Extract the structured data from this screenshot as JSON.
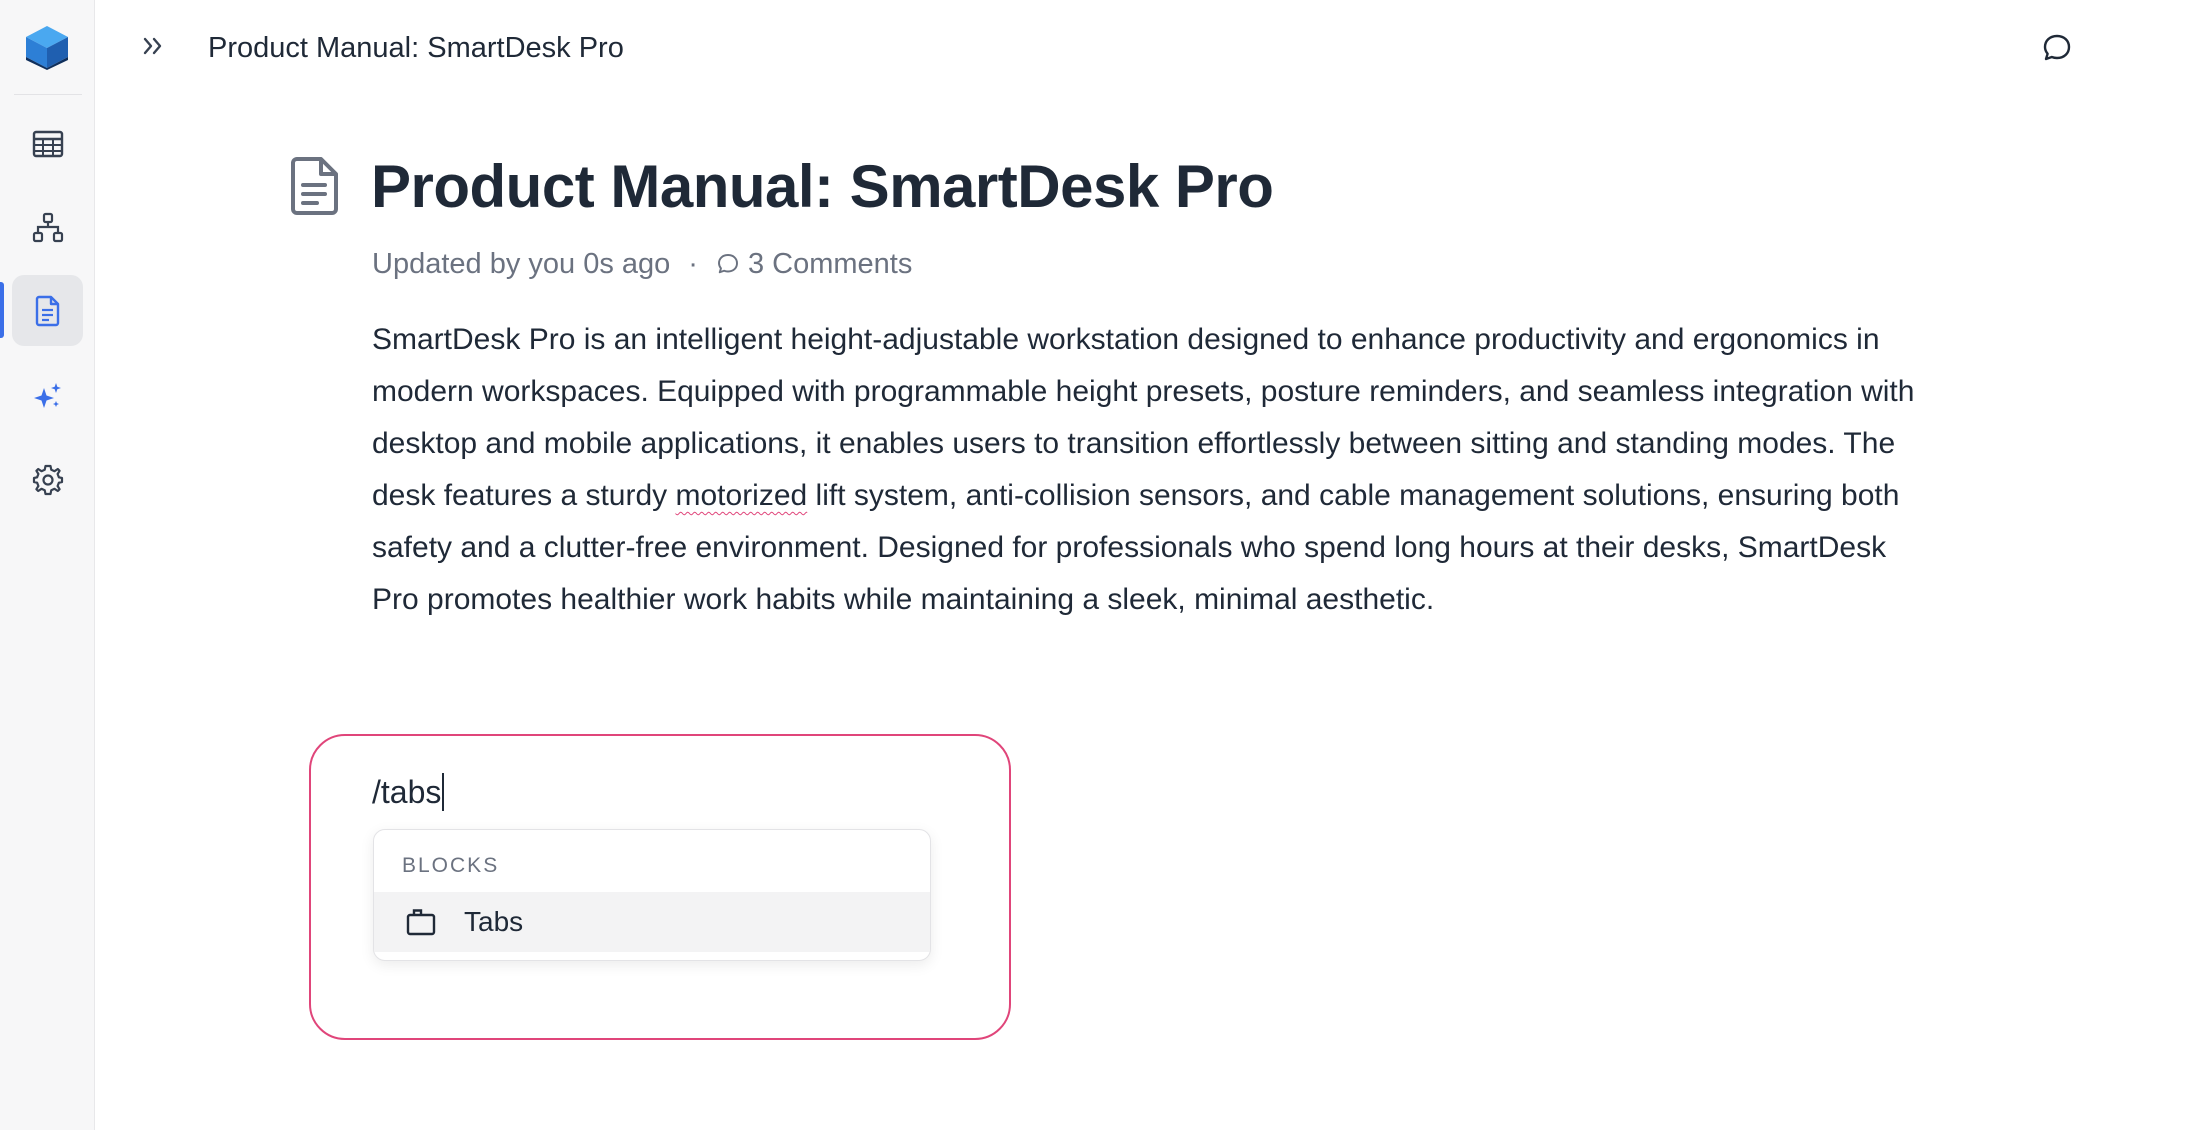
{
  "header": {
    "title": "Product Manual: SmartDesk Pro"
  },
  "sidebar": {
    "items": [
      {
        "name": "tables",
        "icon": "table-grid-icon"
      },
      {
        "name": "schema",
        "icon": "hierarchy-icon"
      },
      {
        "name": "docs",
        "icon": "document-icon",
        "active": true
      },
      {
        "name": "ai",
        "icon": "sparkles-icon"
      },
      {
        "name": "settings",
        "icon": "gear-icon"
      }
    ]
  },
  "document": {
    "title": "Product Manual: SmartDesk Pro",
    "meta_updated": "Updated by you 0s ago",
    "meta_separator": "·",
    "meta_comments": "3 Comments",
    "body_before": "SmartDesk Pro is an intelligent height-adjustable workstation designed to enhance productivity and ergonomics in modern workspaces. Equipped with programmable height presets, posture reminders, and seamless integration with desktop and mobile applications, it enables users to transition effortlessly between sitting and standing modes. The desk features a sturdy ",
    "body_misspelled": "motorized",
    "body_after": " lift system, anti-collision sensors, and cable management solutions, ensuring both safety and a clutter-free environment. Designed for professionals who spend long hours at their desks, SmartDesk Pro promotes healthier work habits while maintaining a sleek, minimal aesthetic."
  },
  "editor": {
    "slash_command": "/tabs",
    "menu": {
      "section_label": "BLOCKS",
      "items": [
        {
          "label": "Tabs",
          "icon": "tabs-icon"
        }
      ]
    }
  },
  "colors": {
    "accent": "#3b6fe8",
    "focus_border": "#e0457a",
    "text": "#1f2937",
    "muted": "#6b7280"
  }
}
